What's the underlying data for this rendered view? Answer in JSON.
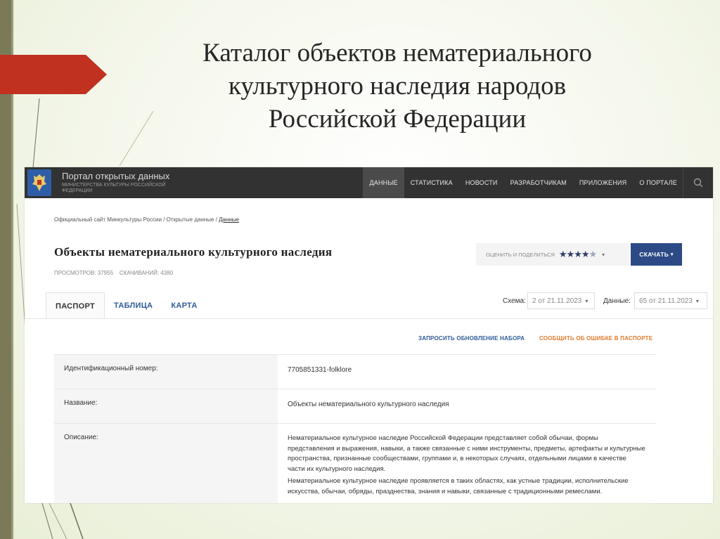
{
  "slide": {
    "title_lines": [
      "Каталог объектов нематериального",
      "культурного наследия народов",
      "Российской Федерации"
    ]
  },
  "portal": {
    "name": "Портал открытых данных",
    "subtitle": "Министерства культуры Российской Федерации",
    "nav": [
      {
        "label": "ДАННЫЕ",
        "active": true
      },
      {
        "label": "СТАТИСТИКА",
        "active": false
      },
      {
        "label": "НОВОСТИ",
        "active": false
      },
      {
        "label": "РАЗРАБОТЧИКАМ",
        "active": false
      },
      {
        "label": "ПРИЛОЖЕНИЯ",
        "active": false
      },
      {
        "label": "О ПОРТАЛЕ",
        "active": false
      }
    ]
  },
  "breadcrumb": {
    "items": [
      "Официальный сайт Минкультуры России",
      "Открытые данные"
    ],
    "separator": " / ",
    "current": "Данные"
  },
  "dataset": {
    "title": "Объекты нематериального культурного наследия",
    "views_label": "ПРОСМОТРОВ:",
    "views": "37955",
    "downloads_label": "СКАЧИВАНИЙ:",
    "downloads": "4380",
    "rate_label": "ОЦЕНИТЬ И ПОДЕЛИТЬСЯ",
    "rating": 4.5,
    "download_label": "СКАЧАТЬ"
  },
  "tabs": [
    {
      "label": "ПАСПОРТ",
      "active": true
    },
    {
      "label": "ТАБЛИЦА",
      "active": false
    },
    {
      "label": "КАРТА",
      "active": false
    }
  ],
  "selectors": {
    "schema_label": "Схема:",
    "schema_value": "2 от 21.11.2023",
    "data_label": "Данные:",
    "data_value": "65 от 21.11.2023"
  },
  "actions": {
    "request_update": "ЗАПРОСИТЬ ОБНОВЛЕНИЕ НАБОРА",
    "report_error": "СООБЩИТЬ ОБ ОШИБКЕ В ПАСПОРТЕ"
  },
  "passport": {
    "id_label": "Идентификационный номер:",
    "id_value": "7705851331-folklore",
    "name_label": "Название:",
    "name_value": "Объекты нематериального культурного наследия",
    "desc_label": "Описание:",
    "desc_p1": "Нематериальное культурное наследие Российской Федерации представляет собой обычаи, формы представления и выражения, навыки, а также связанные с ними инструменты, предметы, артефакты и культурные пространства, признанные сообществами, группами и, в некоторых случаях, отдельными лицами в качестве части их культурного наследия.",
    "desc_p2": "Нематериальное культурное наследие проявляется в таких областях, как устные традиции, исполнительские искусства, обычаи, обряды, празднества, знания и навыки, связанные с традиционными ремеслами."
  },
  "colors": {
    "topbar": "#323232",
    "accent_blue": "#2c4a86",
    "link_blue": "#2c5b9a",
    "link_orange": "#e07a2b",
    "slide_red": "#c0311f",
    "slide_olive": "#7b7a58"
  },
  "icons": {
    "search": "search-icon",
    "emblem": "coat-of-arms-icon"
  }
}
